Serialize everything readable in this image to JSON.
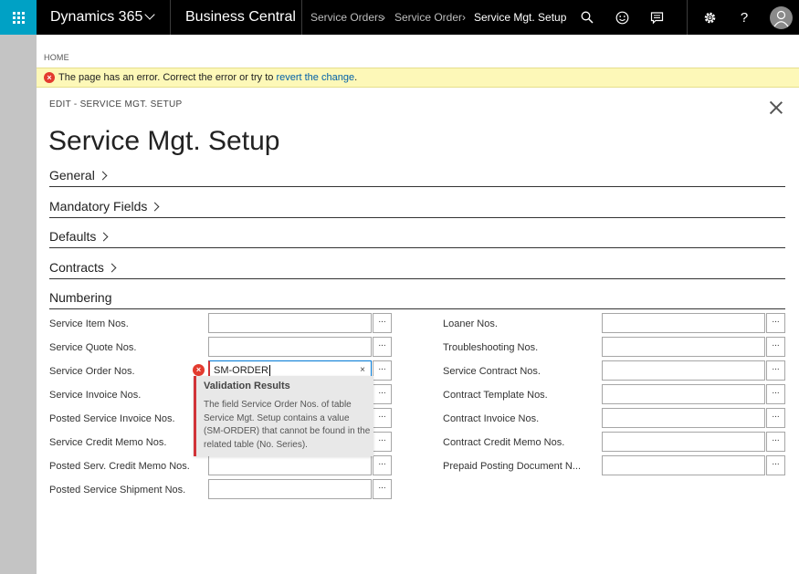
{
  "topbar": {
    "app_name": "Dynamics 365",
    "product": "Business Central",
    "breadcrumbs": [
      "Service Orders",
      "Service Order",
      "Service Mgt. Setup"
    ],
    "icons": [
      "search-icon",
      "smile-icon",
      "chat-icon",
      "gear-icon",
      "help-icon",
      "avatar-icon"
    ],
    "help_glyph": "?",
    "accent_color": "#00a1c5"
  },
  "page": {
    "home_label": "HOME",
    "error": {
      "text": "The page has an error. Correct the error or try to ",
      "link": "revert the change",
      "suffix": ".",
      "icon_glyph": "×"
    },
    "edit_label": "EDIT - SERVICE MGT. SETUP",
    "title": "Service Mgt. Setup",
    "sections": [
      {
        "label": "General"
      },
      {
        "label": "Mandatory Fields"
      },
      {
        "label": "Defaults"
      },
      {
        "label": "Contracts"
      },
      {
        "label": "Numbering"
      }
    ],
    "lookup_label": "...",
    "left_fields": [
      {
        "label": "Service Item Nos.",
        "value": ""
      },
      {
        "label": "Service Quote Nos.",
        "value": ""
      },
      {
        "label": "Service Order Nos.",
        "value": "SM-ORDER"
      },
      {
        "label": "Service Invoice Nos.",
        "value": ""
      },
      {
        "label": "Posted Service Invoice Nos.",
        "value": ""
      },
      {
        "label": "Service Credit Memo Nos.",
        "value": ""
      },
      {
        "label": "Posted Serv. Credit Memo Nos.",
        "value": ""
      },
      {
        "label": "Posted Service Shipment Nos.",
        "value": ""
      }
    ],
    "right_fields": [
      {
        "label": "Loaner Nos.",
        "value": ""
      },
      {
        "label": "Troubleshooting Nos.",
        "value": ""
      },
      {
        "label": "Service Contract Nos.",
        "value": ""
      },
      {
        "label": "Contract Template Nos.",
        "value": ""
      },
      {
        "label": "Contract Invoice Nos.",
        "value": ""
      },
      {
        "label": "Contract Credit Memo Nos.",
        "value": ""
      },
      {
        "label": "Prepaid Posting Document N...",
        "value": ""
      }
    ],
    "active_field_clear": "×",
    "validation": {
      "title": "Validation Results",
      "body": "The field Service Order Nos. of table Service Mgt. Setup contains a value (SM-ORDER) that cannot be found in the related table (No. Series)."
    }
  }
}
